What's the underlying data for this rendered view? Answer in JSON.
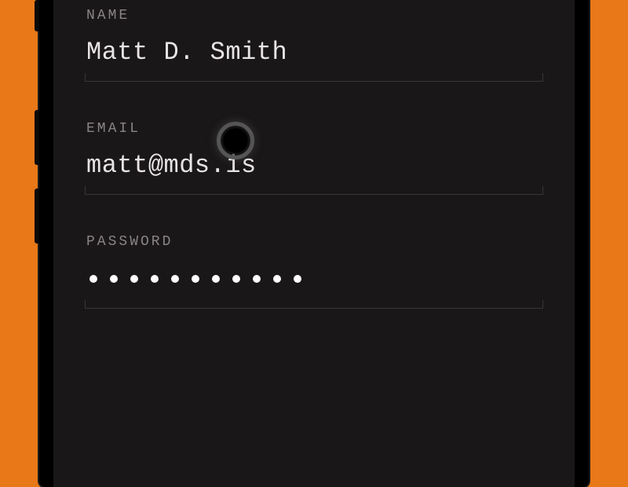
{
  "form": {
    "name": {
      "label": "NAME",
      "value": "Matt D. Smith"
    },
    "email": {
      "label": "EMAIL",
      "value": "matt@mds.is"
    },
    "password": {
      "label": "PASSWORD",
      "dot_count": 11
    }
  }
}
